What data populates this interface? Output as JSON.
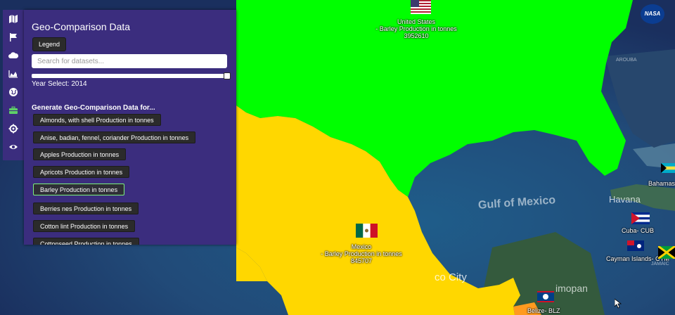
{
  "rail": {
    "icons": [
      "map-icon",
      "flag-icon",
      "cloud-icon",
      "area-chart-icon",
      "globe-icon",
      "briefcase-icon",
      "gear-icon",
      "eye-icon"
    ]
  },
  "panel": {
    "title": "Geo-Comparison Data",
    "legend_label": "Legend",
    "search_placeholder": "Search for datasets...",
    "year_label": "Year Select: 2014",
    "generate_label": "Generate Geo-Comparison Data for...",
    "datasets": [
      "Almonds, with shell Production in tonnes",
      "Anise, badian, fennel, coriander Production in tonnes",
      "Apples Production in tonnes",
      "Apricots Production in tonnes",
      "Barley Production in tonnes",
      "Berries nes Production in tonnes",
      "Cotton lint Production in tonnes",
      "Cottonseed Production in tonnes"
    ],
    "selected_dataset": "Barley Production in tonnes"
  },
  "map": {
    "logo": "NASA",
    "countries": [
      {
        "name": "United States",
        "metric": "- Barley Production in tonnes",
        "value": "3952610"
      },
      {
        "name": "Mexico",
        "metric": "- Barley Production in tonnes",
        "value": "845707"
      }
    ],
    "labels": {
      "gulf": "Gulf of Mexico",
      "havana": "Havana",
      "city": "co City",
      "campeche": "imopan",
      "arouba": "AROUBA",
      "jamaica": "JAMAIC"
    },
    "markers": [
      {
        "name": "Bahamas-"
      },
      {
        "name": "Cuba- CUB"
      },
      {
        "name": "Cayman Islands- CYM"
      },
      {
        "name": "Belize- BLZ"
      }
    ],
    "colors": {
      "usa": "#00ff00",
      "mexico": "#ffd700",
      "ocean": "#1e4470",
      "panel": "#3b2d7e",
      "active_border": "#7cf27c"
    }
  }
}
